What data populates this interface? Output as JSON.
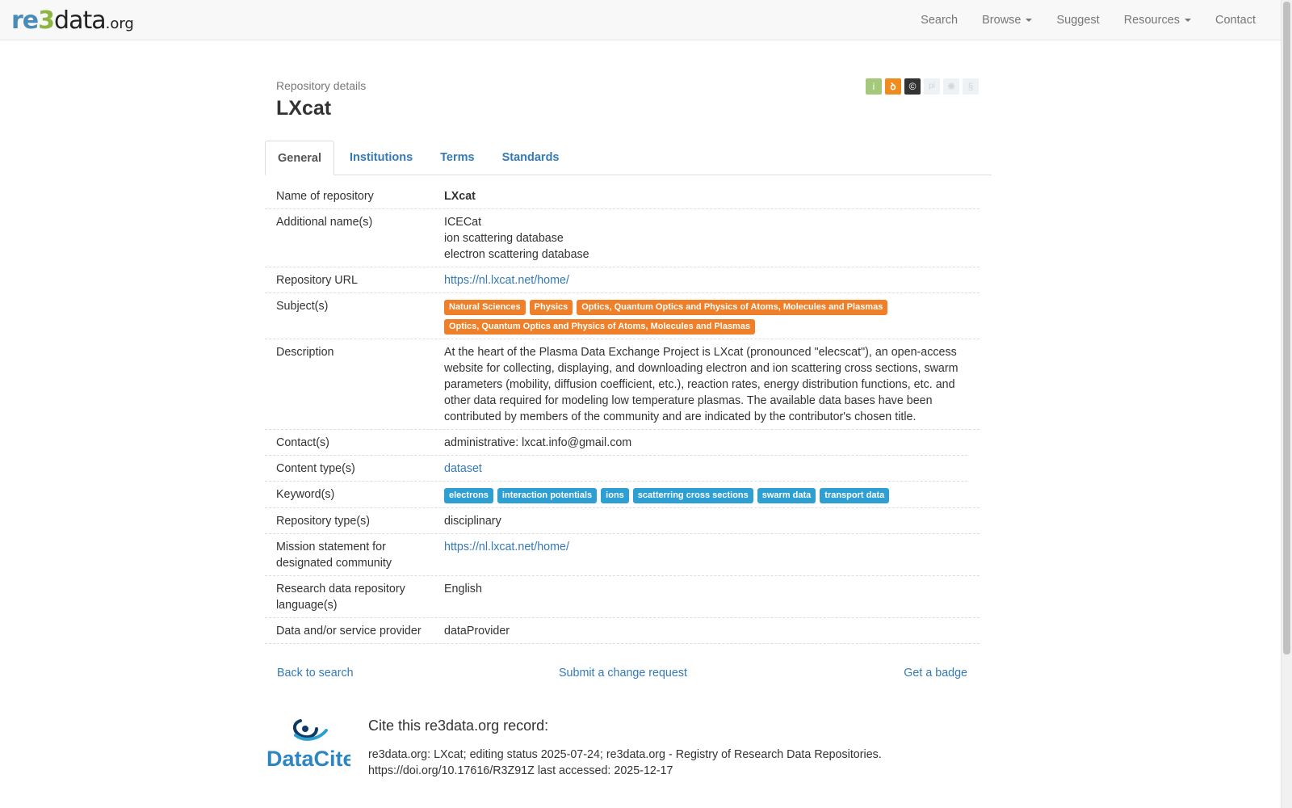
{
  "header": {
    "logo": {
      "re": "re",
      "three": "3",
      "data": "data",
      "org": ".org"
    },
    "nav": [
      {
        "label": "Search",
        "dropdown": false
      },
      {
        "label": "Browse",
        "dropdown": true
      },
      {
        "label": "Suggest",
        "dropdown": false
      },
      {
        "label": "Resources",
        "dropdown": true
      },
      {
        "label": "Contact",
        "dropdown": false
      }
    ]
  },
  "page": {
    "subtitle": "Repository details",
    "title": "LXcat",
    "icons": {
      "info": "i",
      "open_access": "ꝺ",
      "license": "©",
      "pid": "pi",
      "certificate": "✺",
      "policy": "§"
    }
  },
  "tabs": [
    "General",
    "Institutions",
    "Terms",
    "Standards"
  ],
  "details": {
    "name_label": "Name of repository",
    "name_value": "LXcat",
    "additional_label": "Additional name(s)",
    "additional_values": [
      "ICECat",
      "ion scattering database",
      "electron scattering database"
    ],
    "url_label": "Repository URL",
    "url_value": "https://nl.lxcat.net/home/",
    "subjects_label": "Subject(s)",
    "subjects": [
      "Natural Sciences",
      "Physics",
      "Optics, Quantum Optics and Physics of Atoms, Molecules and Plasmas",
      "Optics, Quantum Optics and Physics of Atoms, Molecules and Plasmas"
    ],
    "description_label": "Description",
    "description_value": "At the heart of the Plasma Data Exchange Project is LXcat (pronounced \"elecscat\"), an open-access website for collecting, displaying, and downloading electron and ion scattering cross sections, swarm parameters (mobility, diffusion coefficient, etc.), reaction rates, energy distribution functions, etc. and other data required for modeling low temperature plasmas. The available data bases have been contributed by members of the community and are indicated by the contributor's chosen title.",
    "contacts_label": "Contact(s)",
    "contacts_value": "administrative: lxcat.info@gmail.com",
    "content_type_label": "Content type(s)",
    "content_type_value": "dataset",
    "keywords_label": "Keyword(s)",
    "keywords": [
      "electrons",
      "interaction potentials",
      "ions",
      "scatterring cross sections",
      "swarm data",
      "transport data"
    ],
    "repo_type_label": "Repository type(s)",
    "repo_type_value": "disciplinary",
    "mission_label": "Mission statement for designated community",
    "mission_value": "https://nl.lxcat.net/home/",
    "language_label": "Research data repository language(s)",
    "language_value": "English",
    "provider_label": "Data and/or service provider",
    "provider_value": "dataProvider"
  },
  "footer_links": {
    "back": "Back to search",
    "change": "Submit a change request",
    "badge": "Get a badge"
  },
  "cite": {
    "logo_text": "DataCite",
    "title": "Cite this re3data.org record:",
    "line1": "re3data.org: LXcat; editing status 2025-07-24; re3data.org - Registry of Research Data Repositories.",
    "line2": "https://doi.org/10.17616/R3Z91Z last accessed: 2025-12-17"
  },
  "colors": {
    "link": "#337ab7",
    "subject_badge": "#ef7f29",
    "keyword_badge": "#2e9fd3",
    "logo_blue": "#4a8bb7",
    "logo_green": "#8cb640"
  }
}
